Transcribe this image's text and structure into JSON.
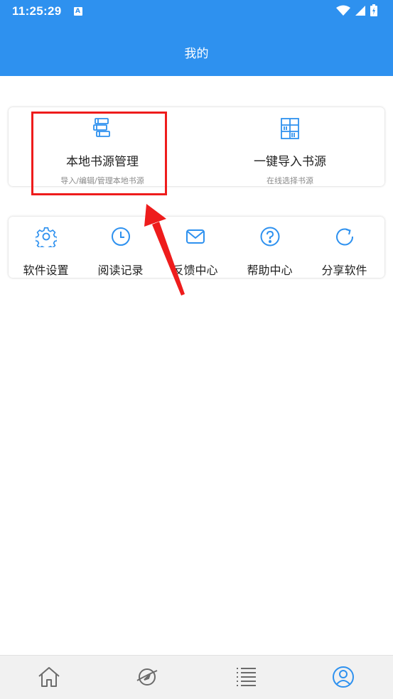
{
  "status_bar": {
    "time": "11:25:29",
    "notification_icon": "A",
    "icons": [
      "wifi-icon",
      "signal-icon",
      "battery-icon"
    ]
  },
  "header": {
    "title": "我的"
  },
  "book_sources": [
    {
      "icon": "books-icon",
      "title": "本地书源管理",
      "subtitle": "导入/编辑/管理本地书源"
    },
    {
      "icon": "bookshelf-icon",
      "title": "一键导入书源",
      "subtitle": "在线选择书源"
    }
  ],
  "tools": [
    {
      "icon": "gear-icon",
      "label": "软件设置"
    },
    {
      "icon": "clock-icon",
      "label": "阅读记录"
    },
    {
      "icon": "mail-icon",
      "label": "反馈中心"
    },
    {
      "icon": "help-icon",
      "label": "帮助中心"
    },
    {
      "icon": "share-icon",
      "label": "分享软件"
    }
  ],
  "bottom_nav": [
    {
      "icon": "home-icon",
      "active": false
    },
    {
      "icon": "discover-icon",
      "active": false
    },
    {
      "icon": "list-icon",
      "active": false
    },
    {
      "icon": "user-icon",
      "active": true
    }
  ],
  "colors": {
    "primary": "#2e91ef",
    "highlight": "#ee1c1c",
    "nav_inactive": "#6b6b6b"
  }
}
